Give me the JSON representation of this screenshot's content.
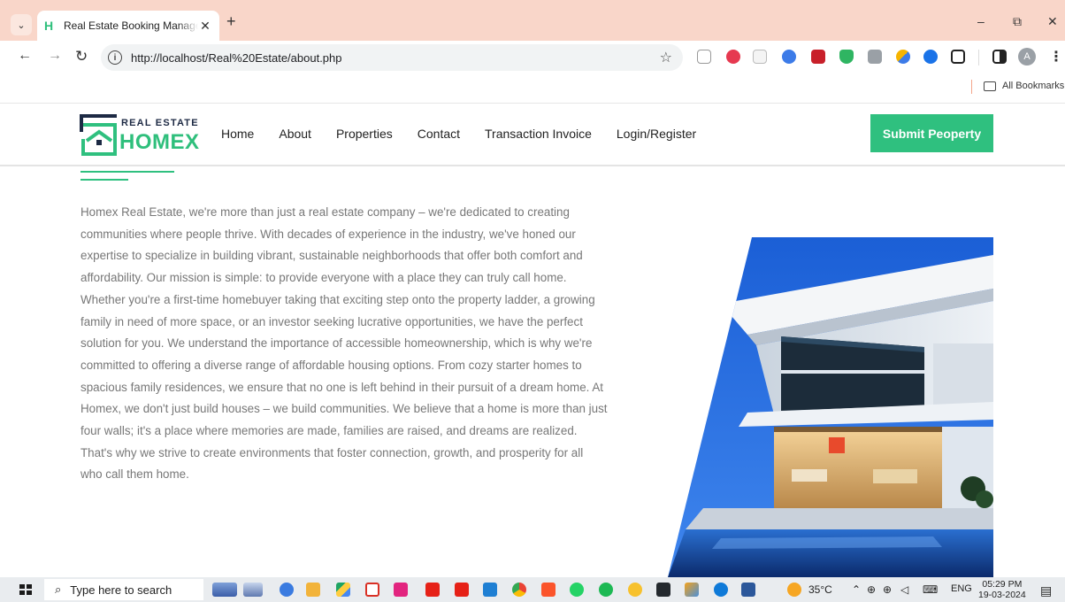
{
  "browser": {
    "tab_title": "Real Estate Booking Management",
    "tab_favicon": "H",
    "url": "http://localhost/Real%20Estate/about.php",
    "bookmarks_label": "All Bookmarks",
    "profile_initial": "A"
  },
  "site": {
    "logo_top": "REAL ESTATE",
    "logo_bottom": "HOMEX",
    "nav": [
      "Home",
      "About",
      "Properties",
      "Contact",
      "Transaction Invoice",
      "Login/Register"
    ],
    "submit_button": "Submit Peoperty",
    "about_paragraph": "Homex Real Estate, we're more than just a real estate company – we're dedicated to creating communities where people thrive. With decades of experience in the industry, we've honed our expertise to specialize in building vibrant, sustainable neighborhoods that offer both comfort and affordability. Our mission is simple: to provide everyone with a place they can truly call home. Whether you're a first-time homebuyer taking that exciting step onto the property ladder, a growing family in need of more space, or an investor seeking lucrative opportunities, we have the perfect solution for you. We understand the importance of accessible homeownership, which is why we're committed to offering a diverse range of affordable housing options. From cozy starter homes to spacious family residences, we ensure that no one is left behind in their pursuit of a dream home. At Homex, we don't just build houses – we build communities. We believe that a home is more than just four walls; it's a place where memories are made, families are raised, and dreams are realized. That's why we strive to create environments that foster connection, growth, and prosperity for all who call them home."
  },
  "taskbar": {
    "search_placeholder": "Type here to search",
    "temperature": "35°C",
    "language": "ENG",
    "time": "05:29 PM",
    "date": "19-03-2024"
  },
  "colors": {
    "accent_green": "#2fc07f",
    "tabbar": "#f9d6c9",
    "body_text": "#777777"
  }
}
